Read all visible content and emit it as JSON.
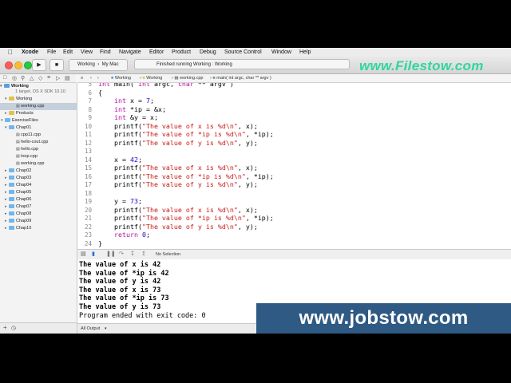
{
  "menubar": {
    "items": [
      "Xcode",
      "File",
      "Edit",
      "View",
      "Find",
      "Navigate",
      "Editor",
      "Product",
      "Debug",
      "Source Control",
      "Window",
      "Help"
    ]
  },
  "toolbar": {
    "scheme_target": "Working",
    "scheme_device": "My Mac",
    "status_text": "Finished running Working : Working"
  },
  "watermark_top": "www.Filestow.com",
  "watermark_bottom": "www.jobstow.com",
  "navigator": {
    "project_name": "Working",
    "project_sub": "1 target, OS X SDK 10.10",
    "items": [
      {
        "label": "Working",
        "type": "group"
      },
      {
        "label": "working.cpp",
        "type": "file"
      },
      {
        "label": "Products",
        "type": "group"
      },
      {
        "label": "ExerciseFiles",
        "type": "folder"
      },
      {
        "label": "Chap01",
        "type": "folder"
      },
      {
        "label": "cpp11.cpp",
        "type": "file"
      },
      {
        "label": "hello-cout.cpp",
        "type": "file"
      },
      {
        "label": "hello.cpp",
        "type": "file"
      },
      {
        "label": "loop.cpp",
        "type": "file"
      },
      {
        "label": "working.cpp",
        "type": "file"
      },
      {
        "label": "Chap02",
        "type": "folder"
      },
      {
        "label": "Chap03",
        "type": "folder"
      },
      {
        "label": "Chap04",
        "type": "folder"
      },
      {
        "label": "Chap05",
        "type": "folder"
      },
      {
        "label": "Chap06",
        "type": "folder"
      },
      {
        "label": "Chap07",
        "type": "folder"
      },
      {
        "label": "Chap08",
        "type": "folder"
      },
      {
        "label": "Chap09",
        "type": "folder"
      },
      {
        "label": "Chap10",
        "type": "folder"
      }
    ]
  },
  "jumpbar": {
    "crumbs": [
      "Working",
      "Working",
      "working.cpp",
      "main( int argc, char ** argv )"
    ]
  },
  "editor": {
    "lines": [
      {
        "n": "5",
        "text": "int main( int argc, char ** argv )"
      },
      {
        "n": "6",
        "text": "{"
      },
      {
        "n": "7",
        "text": "    int x = 7;"
      },
      {
        "n": "8",
        "text": "    int *ip = &x;"
      },
      {
        "n": "9",
        "text": "    int &y = x;"
      },
      {
        "n": "10",
        "text": "    printf(\"The value of x is %d\\n\", x);"
      },
      {
        "n": "11",
        "text": "    printf(\"The value of *ip is %d\\n\", *ip);"
      },
      {
        "n": "12",
        "text": "    printf(\"The value of y is %d\\n\", y);"
      },
      {
        "n": "13",
        "text": ""
      },
      {
        "n": "14",
        "text": "    x = 42;"
      },
      {
        "n": "15",
        "text": "    printf(\"The value of x is %d\\n\", x);"
      },
      {
        "n": "16",
        "text": "    printf(\"The value of *ip is %d\\n\", *ip);"
      },
      {
        "n": "17",
        "text": "    printf(\"The value of y is %d\\n\", y);"
      },
      {
        "n": "18",
        "text": ""
      },
      {
        "n": "19",
        "text": "    y = 73;"
      },
      {
        "n": "20",
        "text": "    printf(\"The value of x is %d\\n\", x);"
      },
      {
        "n": "21",
        "text": "    printf(\"The value of *ip is %d\\n\", *ip);"
      },
      {
        "n": "22",
        "text": "    printf(\"The value of y is %d\\n\", y);"
      },
      {
        "n": "23",
        "text": "    return 0;"
      },
      {
        "n": "24",
        "text": "}"
      }
    ]
  },
  "debugbar": {
    "selection": "No Selection"
  },
  "console": {
    "lines": [
      "The value of x is 42",
      "The value of *ip is 42",
      "The value of y is 42",
      "The value of x is 73",
      "The value of *ip is 73",
      "The value of y is 73",
      "Program ended with exit code: 0"
    ],
    "filter": "All Output"
  }
}
